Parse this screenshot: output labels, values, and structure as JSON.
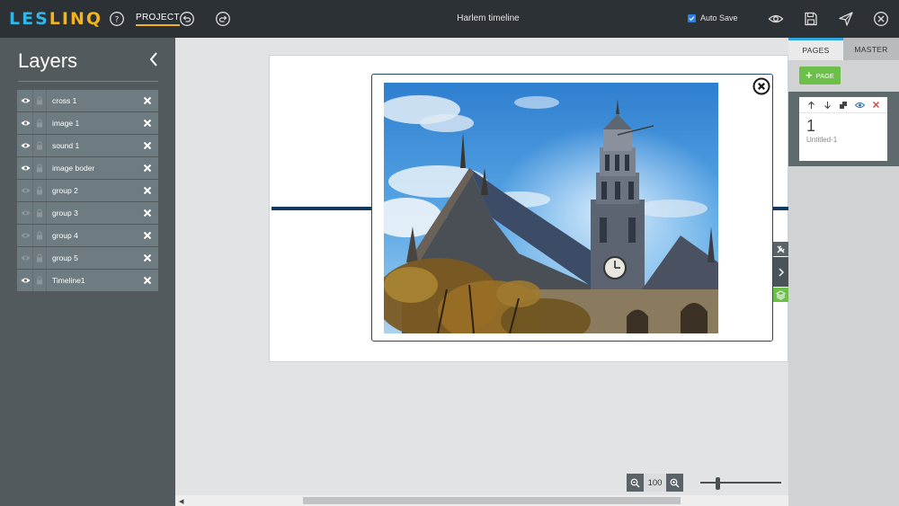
{
  "topbar": {
    "logo_part1": "LES",
    "logo_part2": "LINQ",
    "project_label": "PROJECT",
    "document_title": "Harlem timeline",
    "autosave_label": "Auto Save",
    "autosave_checked": true
  },
  "layers_panel": {
    "title": "Layers",
    "items": [
      {
        "label": "cross 1",
        "visible": true
      },
      {
        "label": "image 1",
        "visible": true
      },
      {
        "label": "sound 1",
        "visible": true
      },
      {
        "label": "image boder",
        "visible": true
      },
      {
        "label": "group 2",
        "visible": false
      },
      {
        "label": "group 3",
        "visible": false
      },
      {
        "label": "group 4",
        "visible": false
      },
      {
        "label": "group 5",
        "visible": false
      },
      {
        "label": "Timeline1",
        "visible": true
      }
    ]
  },
  "zoom": {
    "value": "100"
  },
  "pages_panel": {
    "tab_pages": "PAGES",
    "tab_master": "MASTER",
    "add_page_label": "PAGE",
    "pages": [
      {
        "number": "1",
        "name": "Untitled-1"
      }
    ]
  },
  "colors": {
    "topbar_bg": "#2c3135",
    "accent_blue": "#2fb7e8",
    "accent_yellow": "#f2b31b",
    "add_green": "#6cc04a",
    "timeline_navy": "#14385e"
  }
}
